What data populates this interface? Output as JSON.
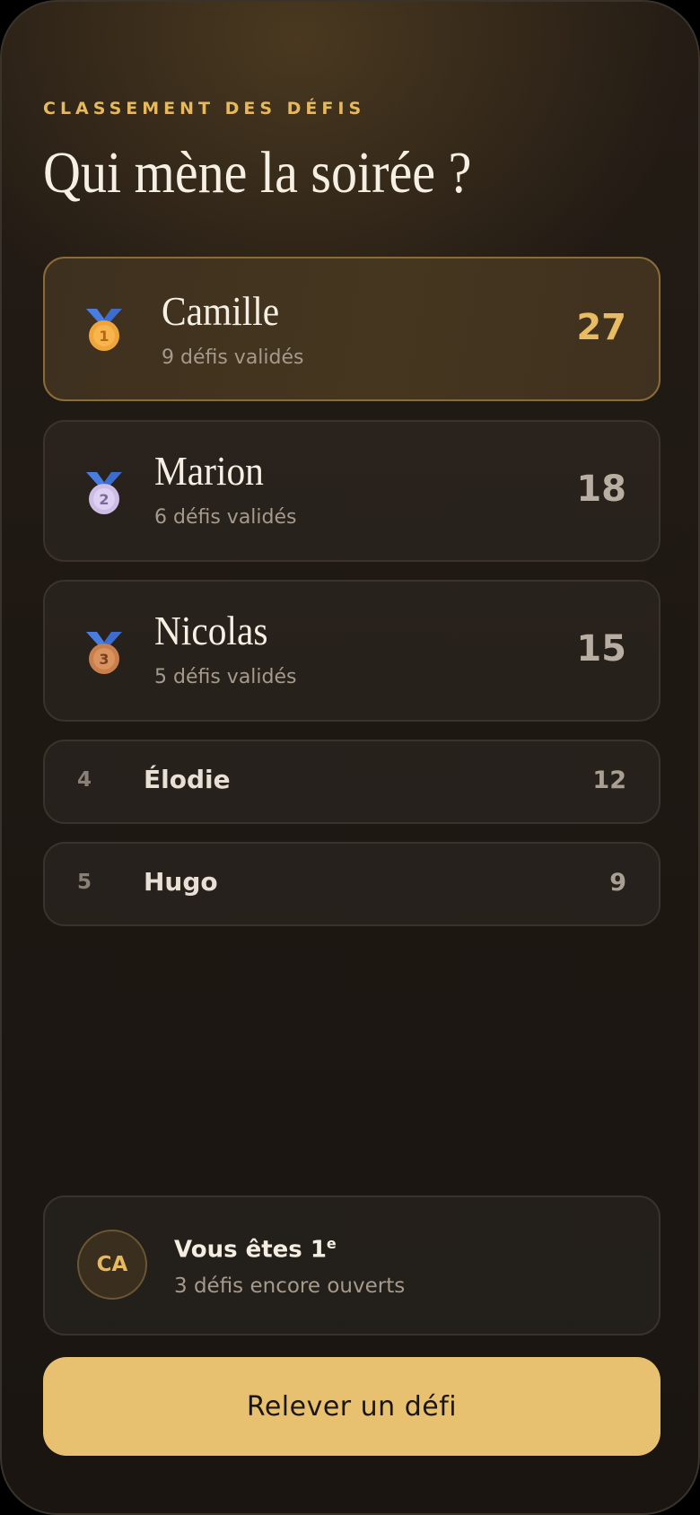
{
  "header": {
    "eyebrow": "CLASSEMENT DES DÉFIS",
    "title": "Qui mène la soirée ?"
  },
  "podium": [
    {
      "rank": "1",
      "medal": "gold-medal-icon",
      "name": "Camille",
      "subtitle": "9 défis validés",
      "score": "27"
    },
    {
      "rank": "2",
      "medal": "silver-medal-icon",
      "name": "Marion",
      "subtitle": "6 défis validés",
      "score": "18"
    },
    {
      "rank": "3",
      "medal": "bronze-medal-icon",
      "name": "Nicolas",
      "subtitle": "5 défis validés",
      "score": "15"
    }
  ],
  "others": [
    {
      "rank": "4",
      "name": "Élodie",
      "score": "12"
    },
    {
      "rank": "5",
      "name": "Hugo",
      "score": "9"
    }
  ],
  "you": {
    "initials": "CA",
    "title_prefix": "Vous êtes 1",
    "title_suffix": "e",
    "subtitle": "3 défis encore ouverts"
  },
  "cta": {
    "label": "Relever un défi"
  },
  "colors": {
    "accent": "#e8c170",
    "gold": "#f0a53a",
    "silver": "#d4c4ea",
    "bronze": "#d08a58",
    "ribbon": "#4a7de0"
  }
}
